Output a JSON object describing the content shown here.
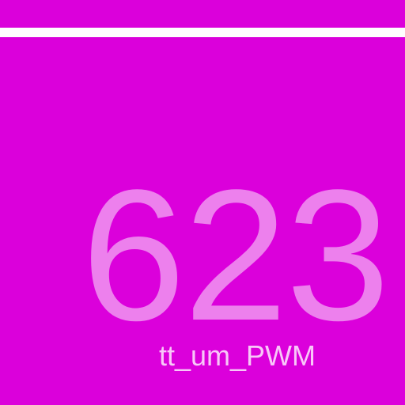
{
  "display": {
    "number": "623",
    "label": "tt_um_PWM"
  },
  "colors": {
    "background": "#db00db",
    "bar": "#ffffff",
    "number": "#ed80ed",
    "label": "#f8c7f8"
  }
}
